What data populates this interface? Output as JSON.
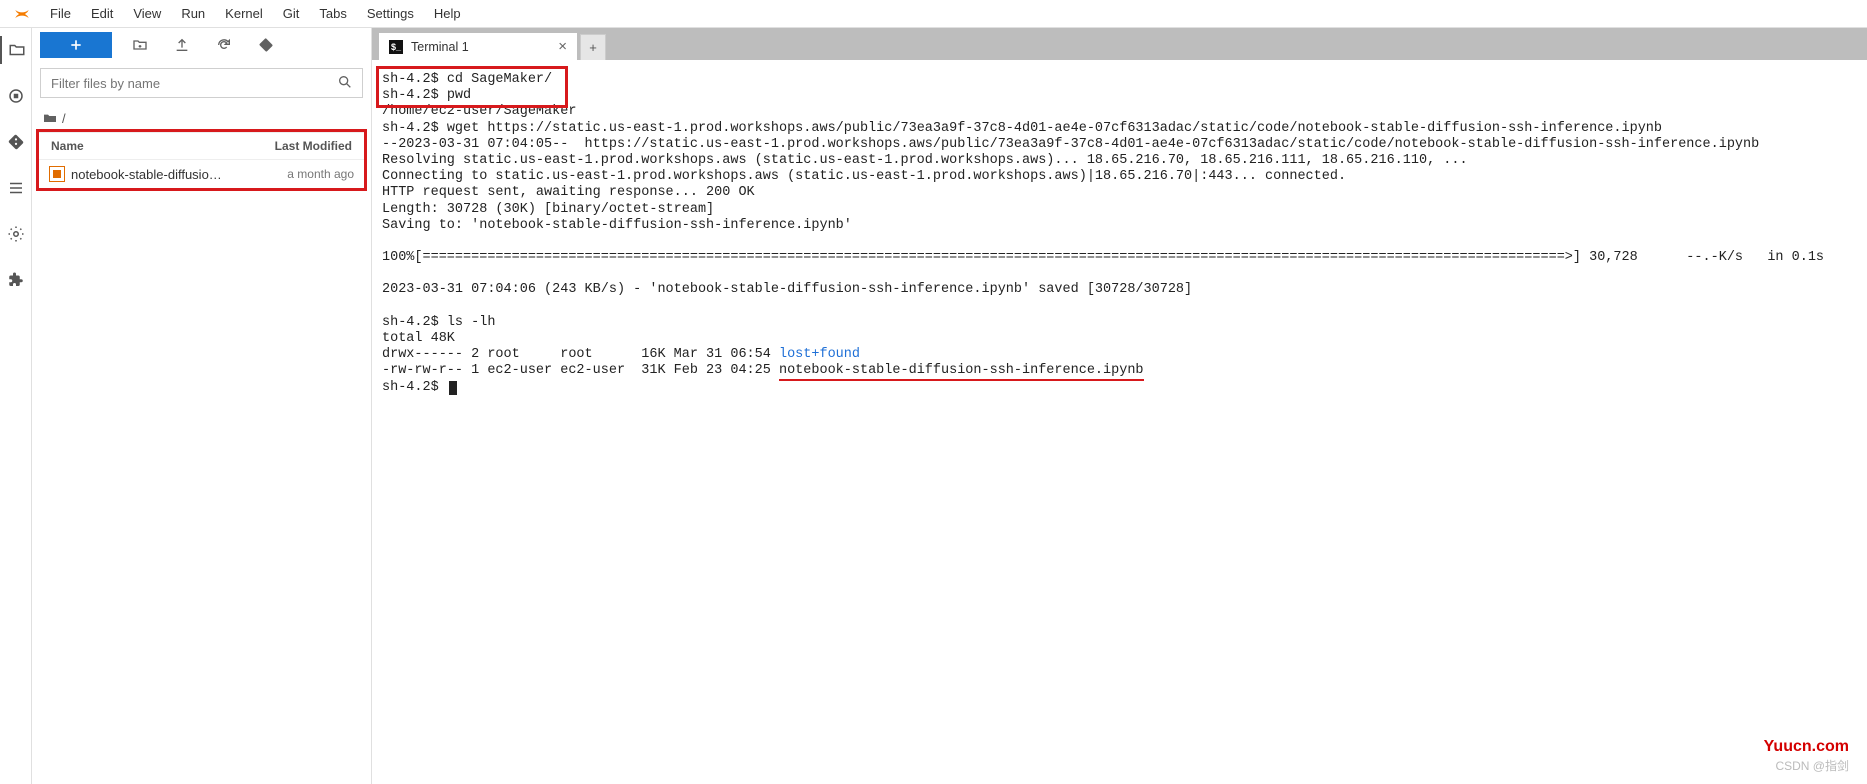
{
  "menu": {
    "items": [
      "File",
      "Edit",
      "View",
      "Run",
      "Kernel",
      "Git",
      "Tabs",
      "Settings",
      "Help"
    ]
  },
  "file_panel": {
    "filter_placeholder": "Filter files by name",
    "breadcrumb_root": "/",
    "columns": {
      "name": "Name",
      "modified": "Last Modified"
    },
    "entries": [
      {
        "name": "notebook-stable-diffusio…",
        "modified": "a month ago"
      }
    ]
  },
  "tabs": {
    "items": [
      {
        "label": "Terminal 1"
      }
    ]
  },
  "terminal": {
    "line1_prompt": "sh-4.2$ ",
    "line1_cmd": "cd SageMaker/",
    "line2_prompt": "sh-4.2$ ",
    "line2_cmd": "pwd",
    "pwd_out": "/home/ec2-user/SageMaker",
    "wget_prompt": "sh-4.2$ ",
    "wget_cmd": "wget https://static.us-east-1.prod.workshops.aws/public/73ea3a9f-37c8-4d01-ae4e-07cf6313adac/static/code/notebook-stable-diffusion-ssh-inference.ipynb",
    "wget_out1": "--2023-03-31 07:04:05--  https://static.us-east-1.prod.workshops.aws/public/73ea3a9f-37c8-4d01-ae4e-07cf6313adac/static/code/notebook-stable-diffusion-ssh-inference.ipynb",
    "wget_out2": "Resolving static.us-east-1.prod.workshops.aws (static.us-east-1.prod.workshops.aws)... 18.65.216.70, 18.65.216.111, 18.65.216.110, ...",
    "wget_out3": "Connecting to static.us-east-1.prod.workshops.aws (static.us-east-1.prod.workshops.aws)|18.65.216.70|:443... connected.",
    "wget_out4": "HTTP request sent, awaiting response... 200 OK",
    "wget_out5": "Length: 30728 (30K) [binary/octet-stream]",
    "wget_out6": "Saving to: 'notebook-stable-diffusion-ssh-inference.ipynb'",
    "wget_progress": "100%[=============================================================================================================================================>] 30,728      --.-K/s   in 0.1s",
    "wget_done": "2023-03-31 07:04:06 (243 KB/s) - 'notebook-stable-diffusion-ssh-inference.ipynb' saved [30728/30728]",
    "ls_prompt": "sh-4.2$ ",
    "ls_cmd": "ls -lh",
    "ls_total": "total 48K",
    "ls_row1_a": "drwx------ 2 root     root      16K Mar 31 06:54 ",
    "ls_row1_link": "lost+found",
    "ls_row2_a": "-rw-rw-r-- 1 ec2-user ec2-user  31K Feb 23 04:25 ",
    "ls_row2_file": "notebook-stable-diffusion-ssh-inference.ipynb",
    "final_prompt": "sh-4.2$ "
  },
  "watermark": {
    "site": "Yuucn.com",
    "csdn": "CSDN @指剑"
  }
}
